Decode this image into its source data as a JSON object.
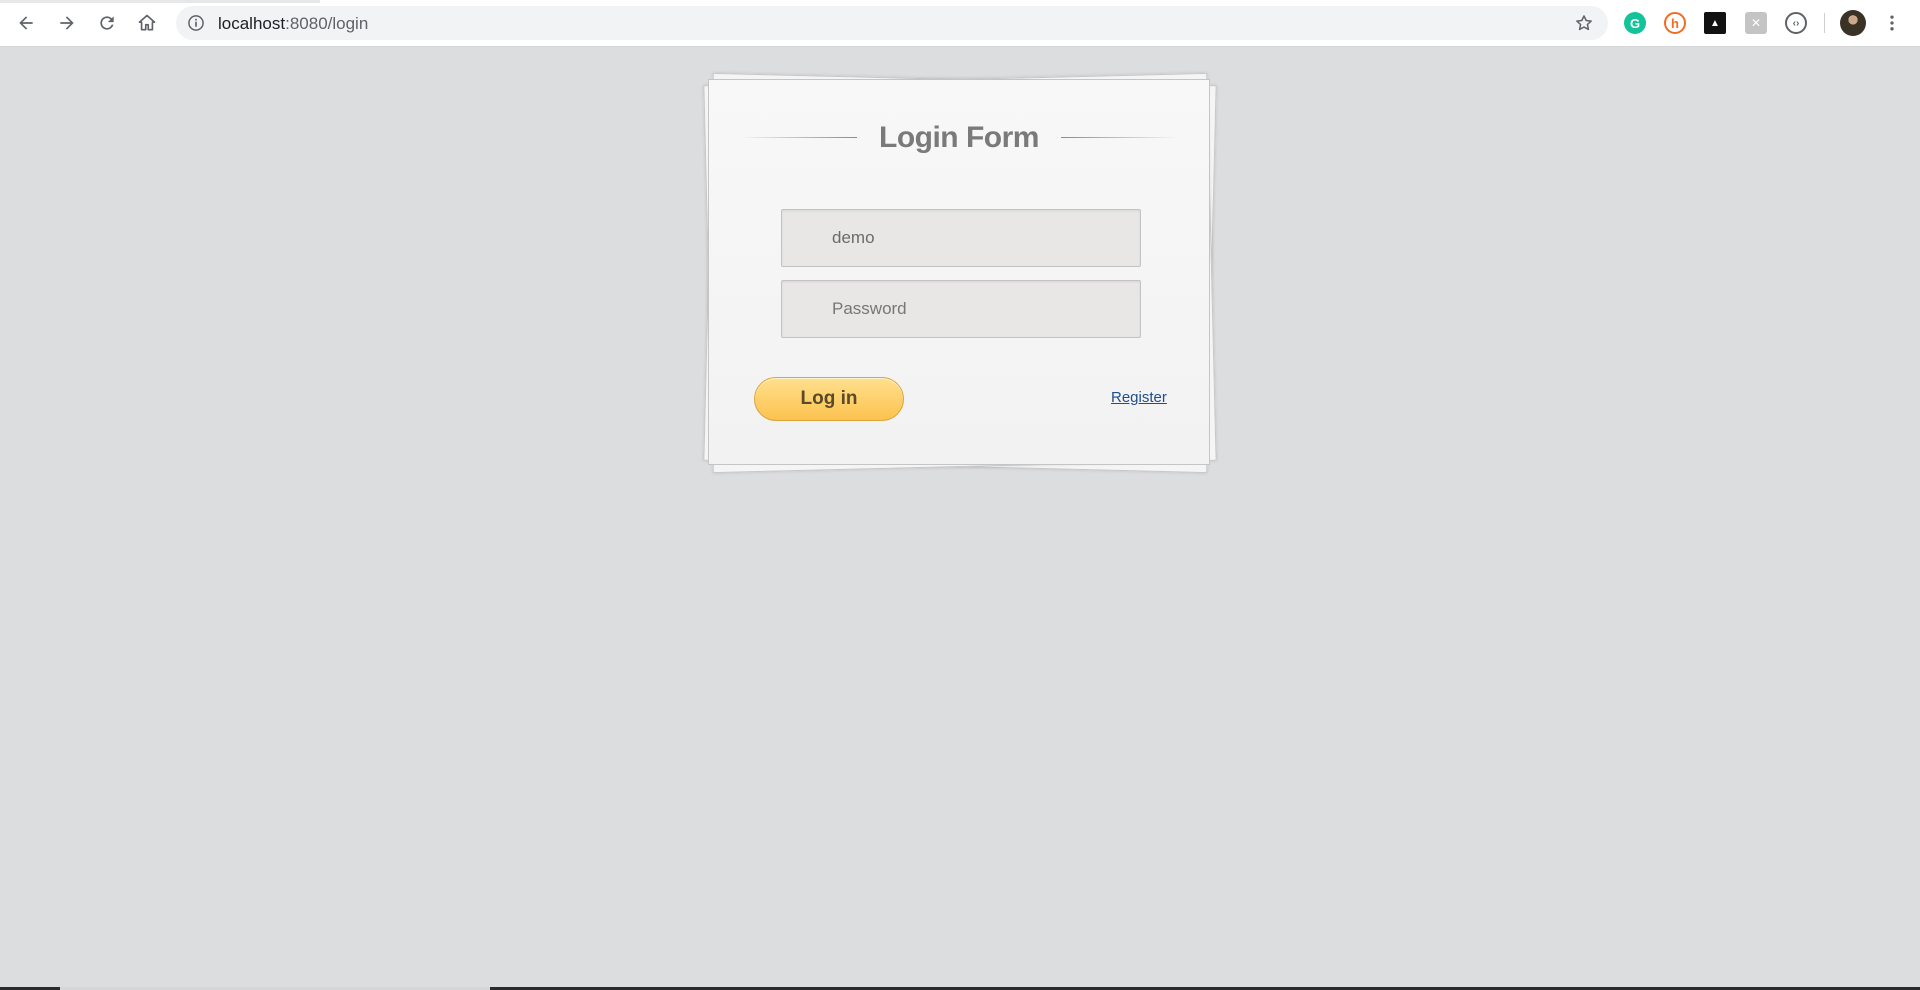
{
  "browser": {
    "url_host": "localhost",
    "url_path": ":8080/login",
    "extensions": [
      {
        "name": "grammarly-icon",
        "glyph": "G",
        "color": "#15c39a"
      },
      {
        "name": "honey-icon",
        "glyph": "h",
        "color": "#f26c22"
      },
      {
        "name": "extension-dark-icon",
        "glyph": "▲",
        "color": "#111111"
      },
      {
        "name": "extension-x-icon",
        "glyph": "✕",
        "color": "#b9b9b9"
      },
      {
        "name": "extension-code-icon",
        "glyph": "‹›",
        "color": "#5f6368"
      }
    ]
  },
  "login": {
    "title": "Login Form",
    "username_value": "demo",
    "password_placeholder": "Password",
    "login_label": "Log in",
    "register_label": "Register"
  },
  "colors": {
    "page_background": "#dcdddf",
    "button_gold": "#fcc24f",
    "link_blue": "#1f4e8a"
  }
}
